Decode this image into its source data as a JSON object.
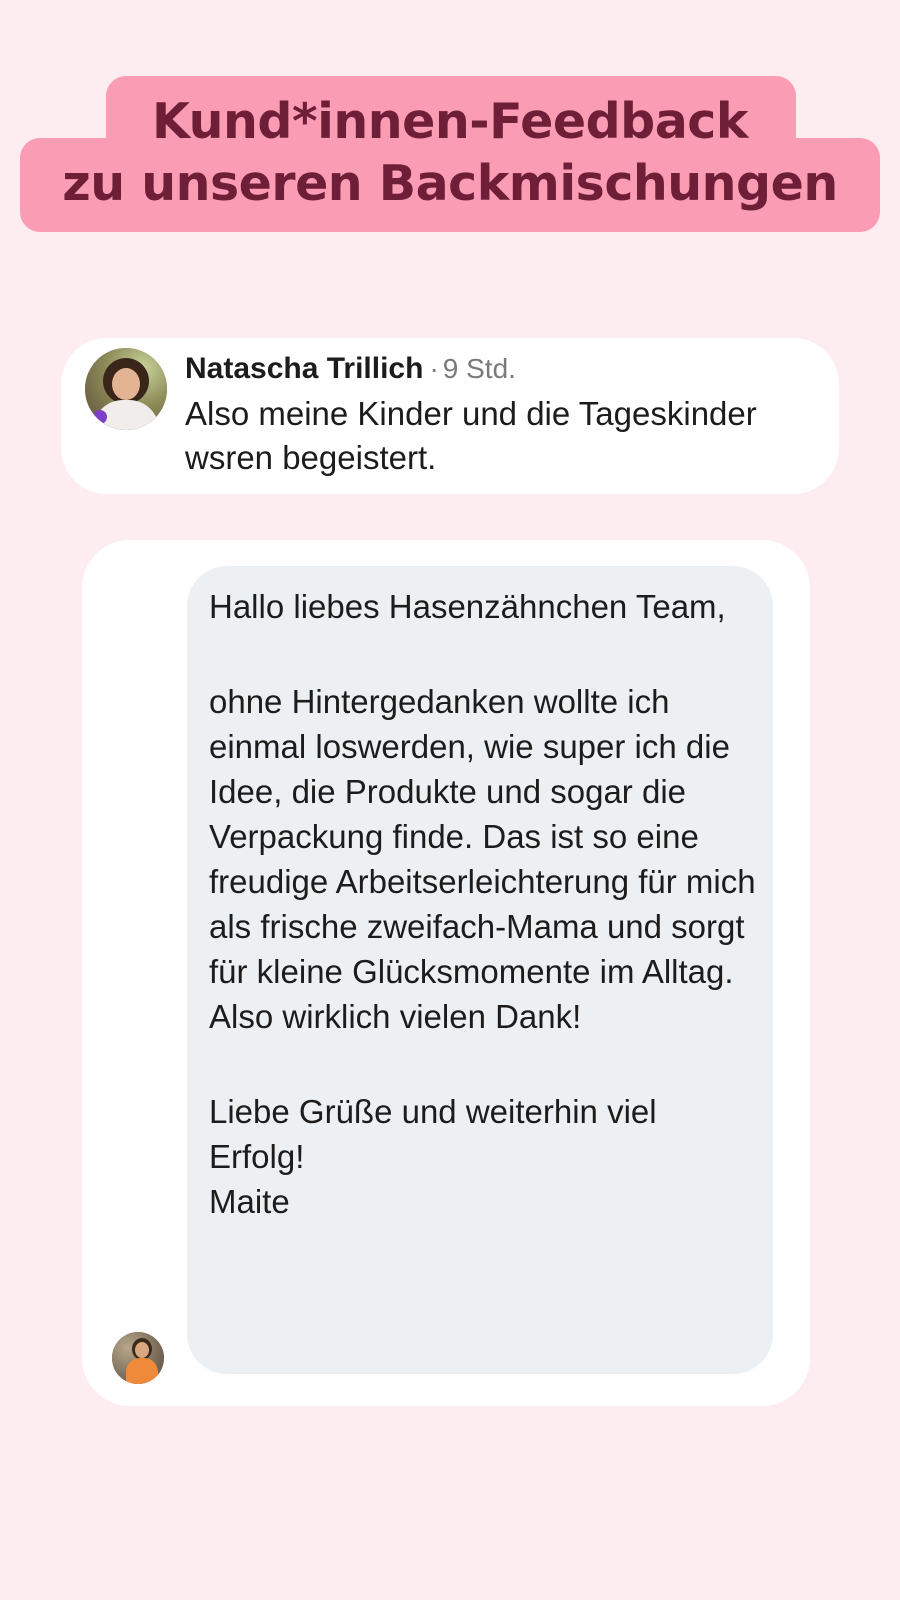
{
  "headline": {
    "line1": "Kund*innen-Feedback",
    "line2": "zu unseren Backmischungen"
  },
  "comment": {
    "author": "Natascha Trillich",
    "separator": "·",
    "time": "9 Std.",
    "text_lines": [
      "Also meine Kinder und die Tageskinder",
      "wsren begeistert."
    ]
  },
  "message": {
    "paragraphs": [
      "Hallo liebes Hasenzähnchen Team,",
      "ohne Hintergedanken wollte ich einmal loswerden, wie super ich die Idee, die Produkte und sogar die Verpackung finde. Das ist so eine freudige Arbeitserleichterung für mich als frische zweifach-Mama und sorgt für kleine Glücksmomente im Alltag. Also wirklich vielen Dank!",
      "Liebe Grüße und weiterhin viel Erfolg!",
      "Maite"
    ]
  },
  "colors": {
    "page_background": "#FEEDF0",
    "headline_highlight": "#F99CB4",
    "headline_text": "#6E1E36",
    "bubble_background": "#EDF0F3",
    "card_background": "#FFFFFF"
  }
}
